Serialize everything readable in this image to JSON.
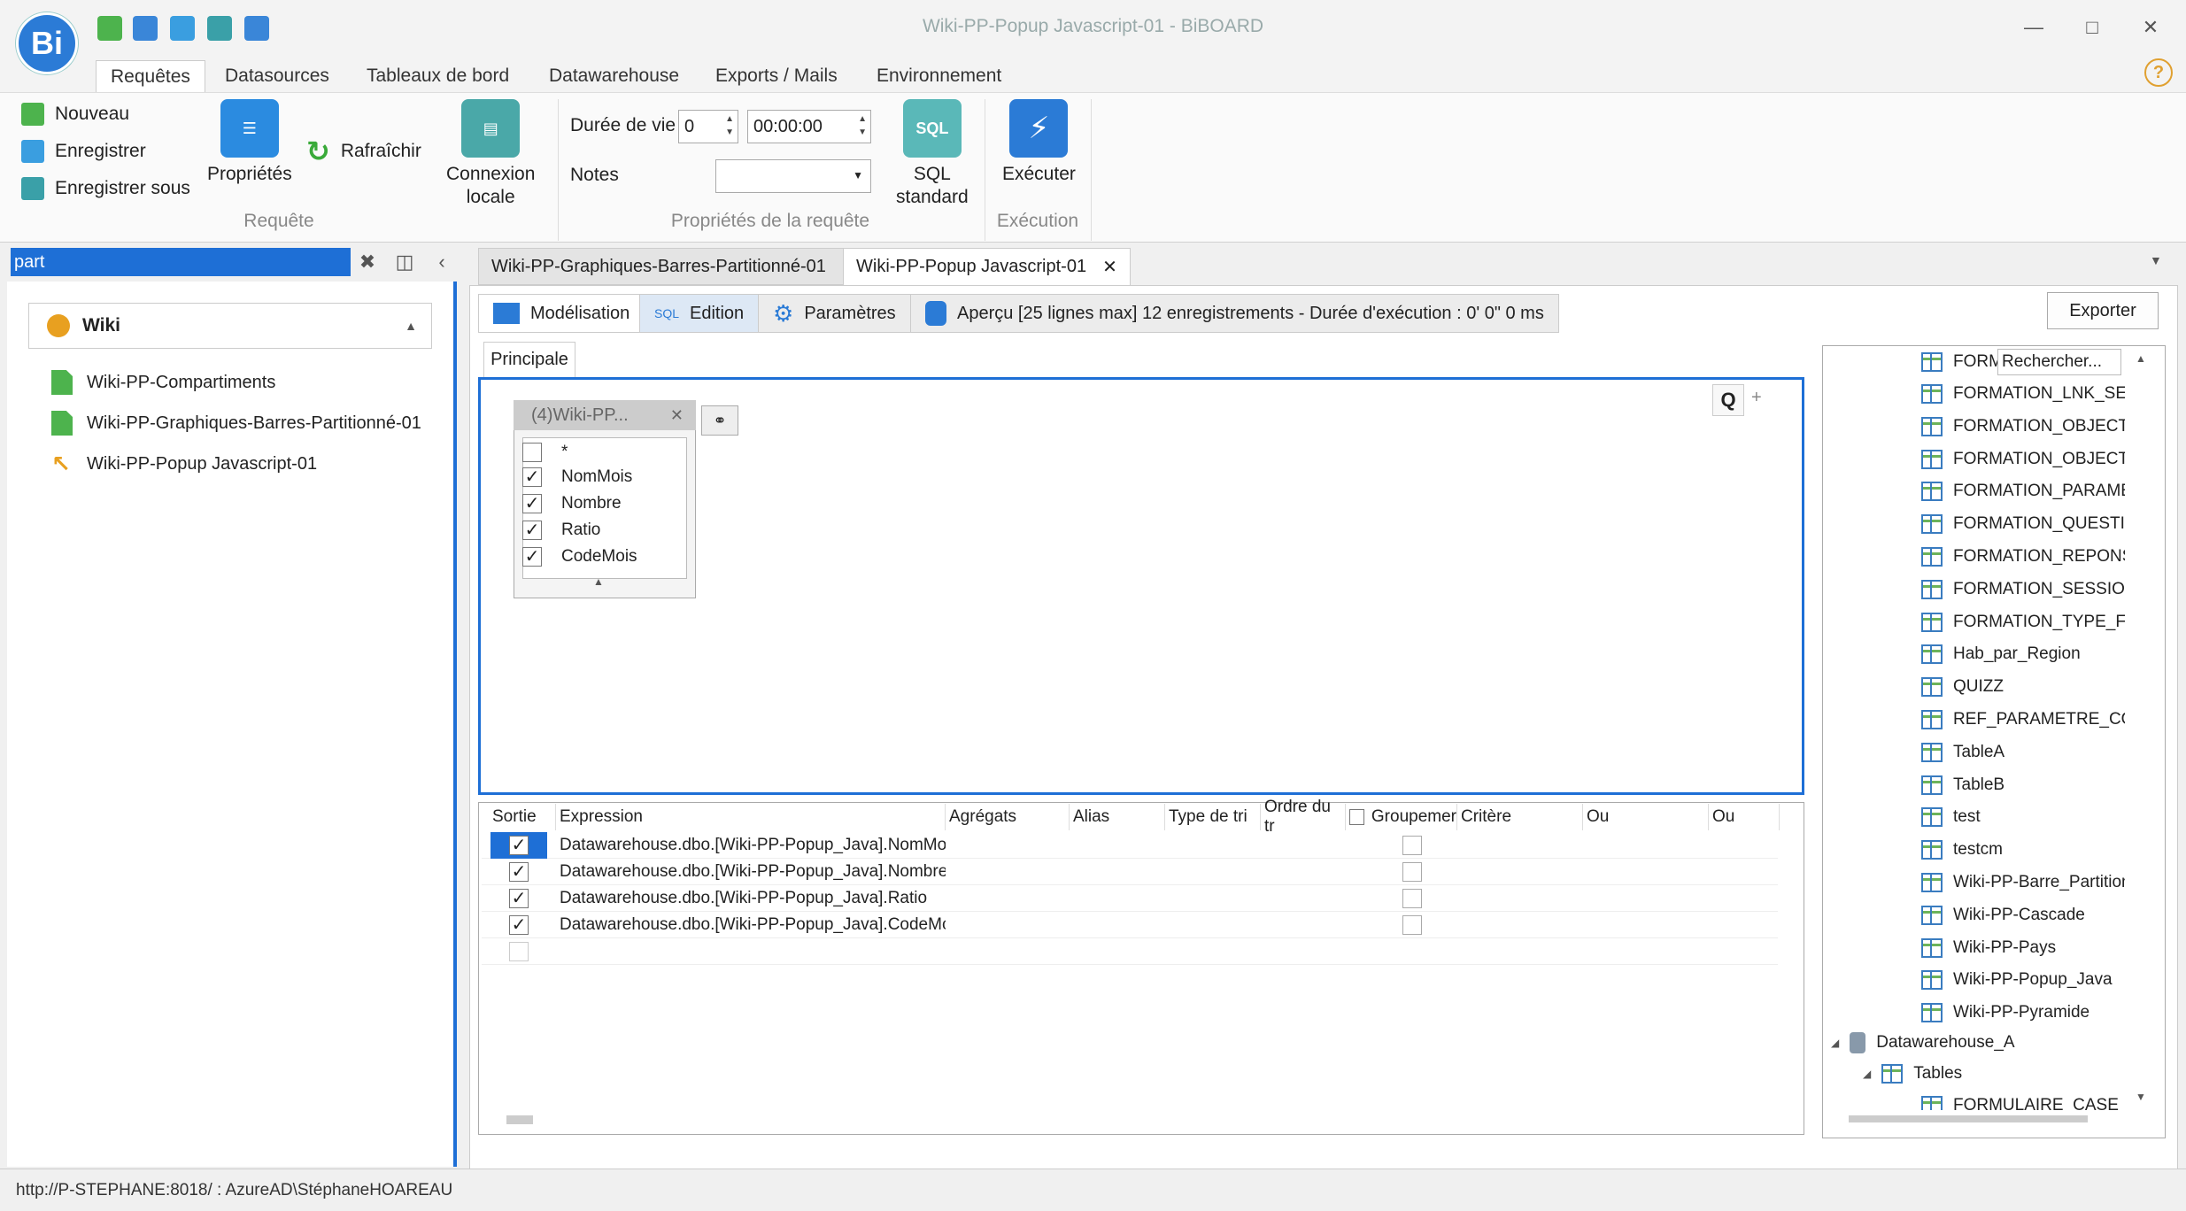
{
  "window": {
    "title": "Wiki-PP-Popup Javascript-01 - BiBOARD",
    "logo": "Bi"
  },
  "menu": {
    "tabs": [
      "Requêtes",
      "Datasources",
      "Tableaux de bord",
      "Datawarehouse",
      "Exports / Mails",
      "Environnement"
    ],
    "active": "Requêtes"
  },
  "ribbon": {
    "requete": {
      "nouveau": "Nouveau",
      "enregistrer": "Enregistrer",
      "enregistrer_sous": "Enregistrer sous",
      "proprietes": "Propriétés",
      "rafraichir": "Rafraîchir",
      "connexion_1": "Connexion",
      "connexion_2": "locale",
      "group_label": "Requête"
    },
    "props": {
      "duree_label": "Durée de vie",
      "duree_value": "0",
      "time_value": "00:00:00",
      "notes_label": "Notes",
      "notes_value": "",
      "sql_icon": "SQL",
      "sql_label_1": "SQL",
      "sql_label_2": "standard",
      "group_label": "Propriétés de la requête"
    },
    "execution": {
      "executer": "Exécuter",
      "group_label": "Exécution"
    }
  },
  "left_panel": {
    "search_value": "part",
    "group_title": "Wiki",
    "items": [
      "Wiki-PP-Compartiments",
      "Wiki-PP-Graphiques-Barres-Partitionné-01",
      "Wiki-PP-Popup Javascript-01"
    ]
  },
  "doc_tabs": [
    {
      "label": "Wiki-PP-Graphiques-Barres-Partitionné-01"
    },
    {
      "label": "Wiki-PP-Popup Javascript-01"
    }
  ],
  "sub_tabs": {
    "modelisation": "Modélisation",
    "edition_prefix": "SQL",
    "edition": "Edition",
    "parametres": "Paramètres",
    "apercu": "Aperçu [25 lignes max] 12 enregistrements - Durée d'exécution : 0' 0\" 0 ms",
    "exporter": "Exporter",
    "principale": "Principale"
  },
  "table_box": {
    "title": "(4)Wiki-PP...",
    "star": "*",
    "fields": [
      {
        "name": "NomMois",
        "checked": true
      },
      {
        "name": "Nombre",
        "checked": true
      },
      {
        "name": "Ratio",
        "checked": true
      },
      {
        "name": "CodeMois",
        "checked": true
      }
    ]
  },
  "grid": {
    "headers": [
      "Sortie",
      "Expression",
      "Agrégats",
      "Alias",
      "Type de tri",
      "Ordre du tr",
      "Groupemer",
      "Critère",
      "Ou",
      "Ou"
    ],
    "rows": [
      {
        "expression": "Datawarehouse.dbo.[Wiki-PP-Popup_Java].NomMoi",
        "checked": true
      },
      {
        "expression": "Datawarehouse.dbo.[Wiki-PP-Popup_Java].Nombre",
        "checked": true
      },
      {
        "expression": "Datawarehouse.dbo.[Wiki-PP-Popup_Java].Ratio",
        "checked": true
      },
      {
        "expression": "Datawarehouse.dbo.[Wiki-PP-Popup_Java].CodeMc",
        "checked": true
      }
    ]
  },
  "right_tree": {
    "search_placeholder": "Rechercher...",
    "first_item_prefix": "FORM",
    "items": [
      "FORMATION_LNK_SES!",
      "FORMATION_OBJECTIF",
      "FORMATION_OBJECTIF",
      "FORMATION_PARAMET",
      "FORMATION_QUESTIO",
      "FORMATION_REPONSE",
      "FORMATION_SESSION",
      "FORMATION_TYPE_FO",
      "Hab_par_Region",
      "QUIZZ",
      "REF_PARAMETRE_COM",
      "TableA",
      "TableB",
      "test",
      "testcm",
      "Wiki-PP-Barre_Partition",
      "Wiki-PP-Cascade",
      "Wiki-PP-Pays",
      "Wiki-PP-Popup_Java",
      "Wiki-PP-Pyramide"
    ],
    "db_node": "Datawarehouse_A",
    "tables_node": "Tables",
    "cut_item": "FORMULAIRE_CASE_C"
  },
  "status": {
    "text": "http://P-STEPHANE:8018/ : AzureAD\\StéphaneHOAREAU"
  },
  "colors": {
    "accent": "#1e6fd6",
    "green": "#4db34d",
    "orange": "#e8a020"
  }
}
